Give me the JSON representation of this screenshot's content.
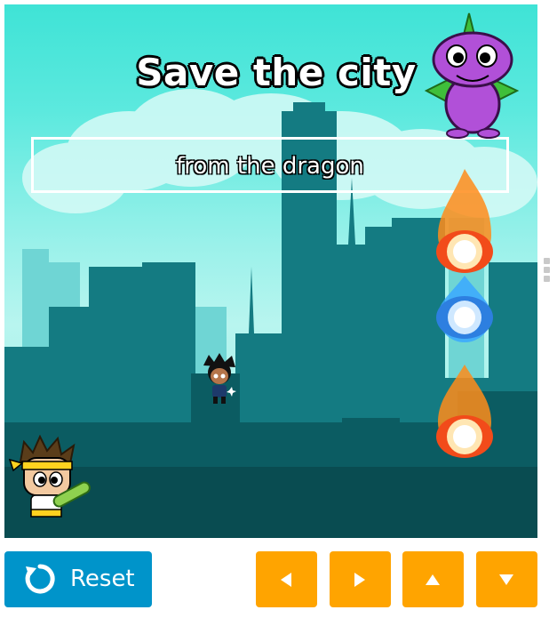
{
  "game": {
    "title": "Save the city",
    "subtitle": "from the dragon",
    "sprites": [
      "dragon",
      "hero-player",
      "villager-kid",
      "fireball-orange",
      "fireball-blue",
      "fireball-orange"
    ]
  },
  "controls": {
    "reset_label": "Reset",
    "arrows": [
      "left",
      "right",
      "up",
      "down"
    ]
  },
  "colors": {
    "reset_button": "#0094ca",
    "arrow_buttons": "#ffa400",
    "sky": "#5ce9de",
    "city_front": "#0b5c62",
    "dragon": "#b150d8"
  }
}
